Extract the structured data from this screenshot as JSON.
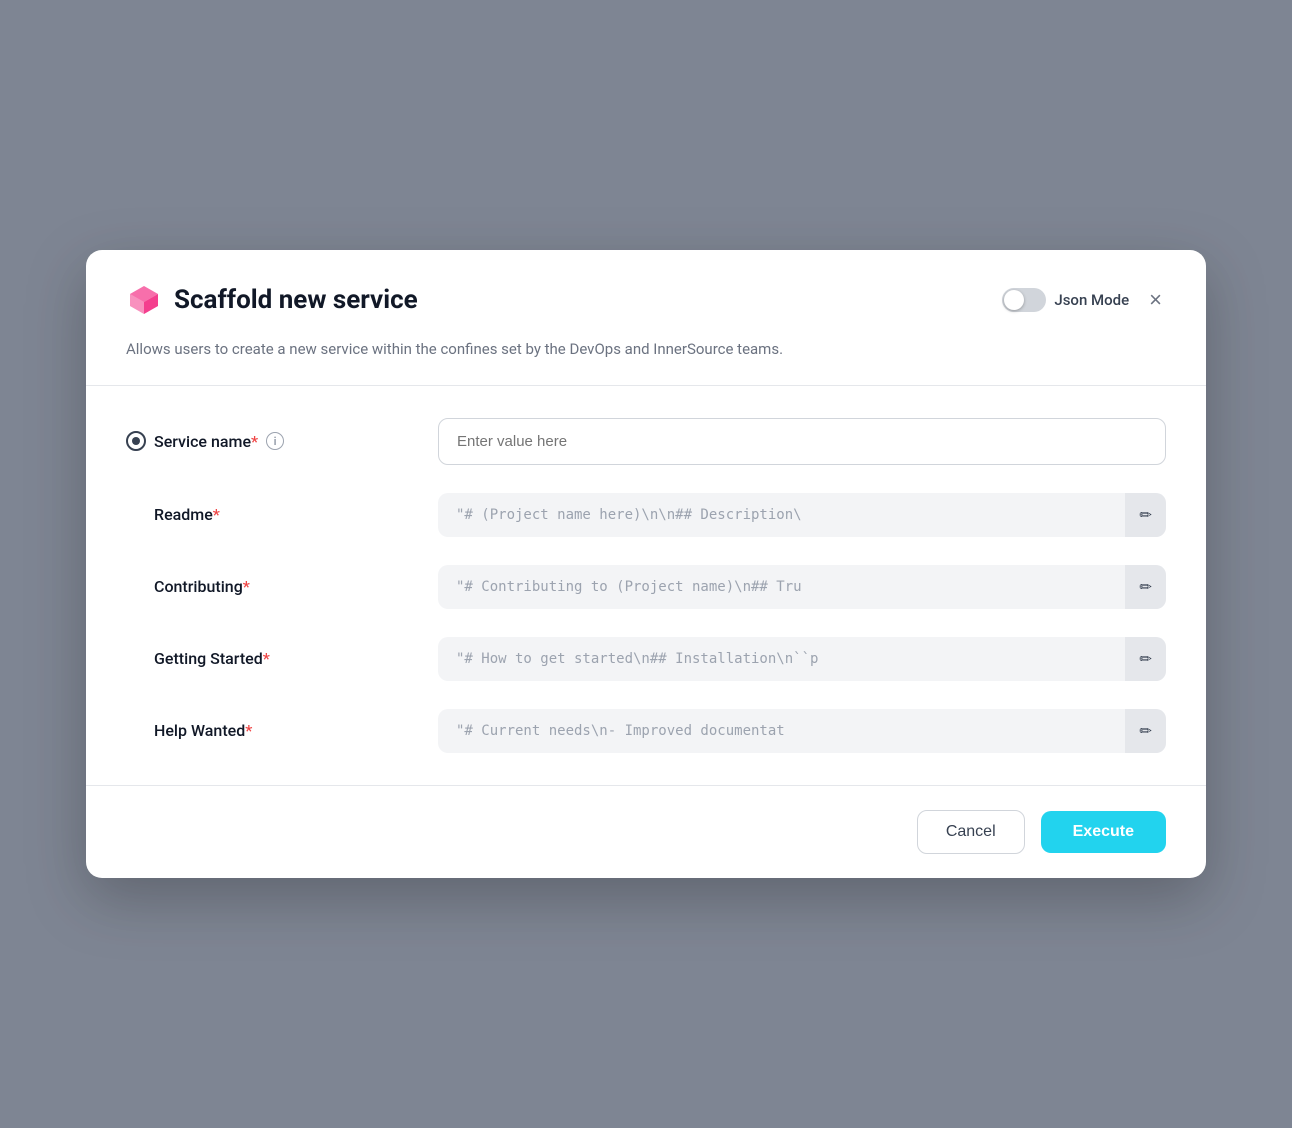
{
  "modal": {
    "title": "Scaffold new service",
    "description": "Allows users to create a new service within the confines set by the DevOps and InnerSource teams.",
    "json_mode_label": "Json Mode",
    "close_label": "×"
  },
  "form": {
    "fields": [
      {
        "id": "service-name",
        "label": "Service name",
        "required": true,
        "show_radio": true,
        "show_info": true,
        "type": "text",
        "placeholder": "Enter value here",
        "value": ""
      },
      {
        "id": "readme",
        "label": "Readme",
        "required": true,
        "show_radio": false,
        "show_info": false,
        "type": "textarea",
        "placeholder": "\"# (Project name here)\\n\\n## Description\\",
        "value": "\"# (Project name here)\\n\\n## Description\\"
      },
      {
        "id": "contributing",
        "label": "Contributing",
        "required": true,
        "show_radio": false,
        "show_info": false,
        "type": "textarea",
        "placeholder": "\"# Contributing to (Project name)\\n## Tru",
        "value": "\"# Contributing to (Project name)\\n## Tru"
      },
      {
        "id": "getting-started",
        "label": "Getting Started",
        "required": true,
        "show_radio": false,
        "show_info": false,
        "type": "textarea",
        "placeholder": "\"# How to get started\\n## Installation\\n``p",
        "value": "\"# How to get started\\n## Installation\\n``p"
      },
      {
        "id": "help-wanted",
        "label": "Help Wanted",
        "required": true,
        "show_radio": false,
        "show_info": false,
        "type": "textarea",
        "placeholder": "\"# Current needs\\n- Improved documentat",
        "value": "\"# Current needs\\n- Improved documentat"
      }
    ]
  },
  "footer": {
    "cancel_label": "Cancel",
    "execute_label": "Execute"
  },
  "icons": {
    "edit": "✏",
    "info": "i",
    "close": "✕"
  }
}
